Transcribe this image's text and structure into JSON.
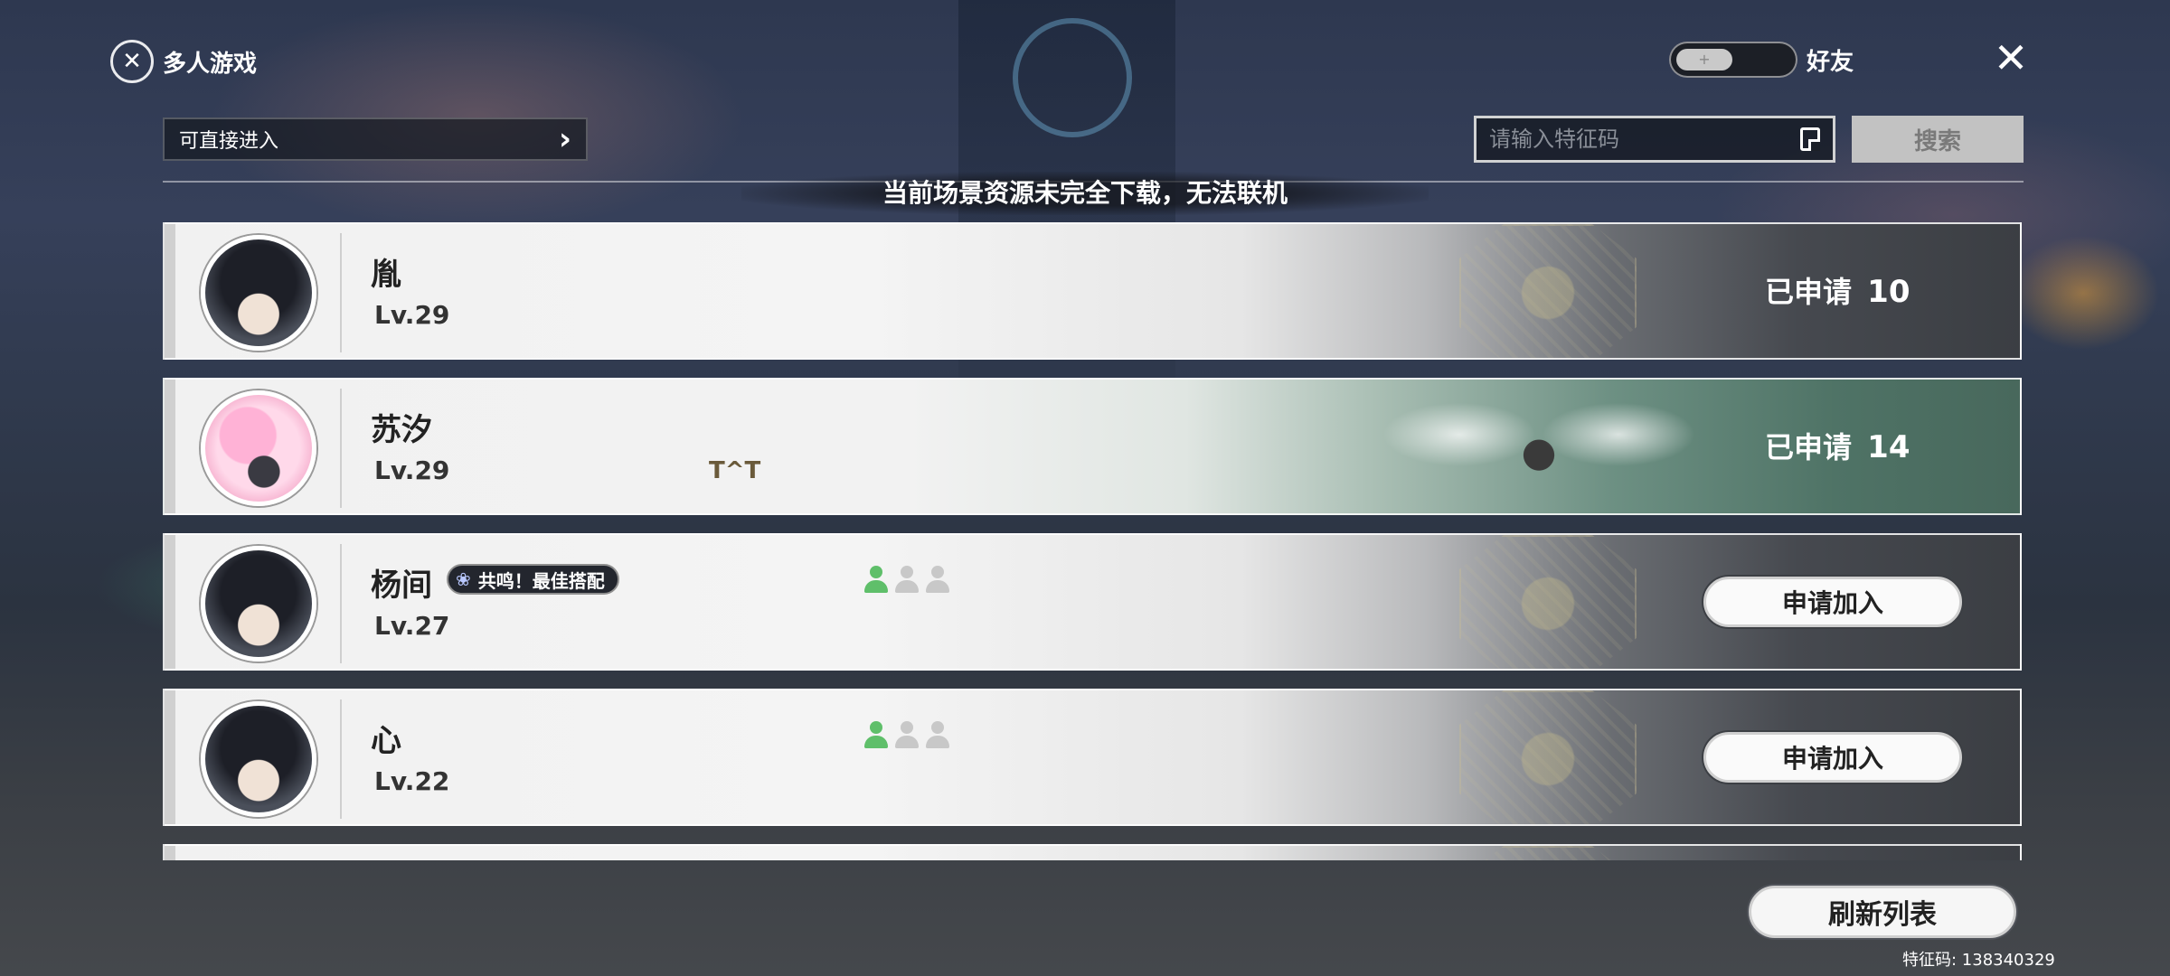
{
  "header": {
    "title": "多人游戏",
    "logo_icon": "multiplayer-globe-icon",
    "friend_toggle_label": "好友",
    "friend_toggle_state": "off",
    "close_icon": "close-icon"
  },
  "filter": {
    "selected": "可直接进入"
  },
  "search": {
    "placeholder": "请输入特征码",
    "button_label": "搜索"
  },
  "notice": "当前场景资源未完全下载，无法联机",
  "players": [
    {
      "name": "胤",
      "level": "Lv.29",
      "status_label": "已申请",
      "status_count": "10",
      "slots": null
    },
    {
      "name": "苏汐",
      "level": "Lv.29",
      "note": "T^T",
      "status_label": "已申请",
      "status_count": "14",
      "slots": null
    },
    {
      "name": "杨间",
      "level": "Lv.27",
      "badge": "共鸣！最佳搭配",
      "slots": [
        true,
        false,
        false
      ],
      "action_label": "申请加入"
    },
    {
      "name": "心",
      "level": "Lv.22",
      "slots": [
        true,
        false,
        false
      ],
      "action_label": "申请加入"
    }
  ],
  "refresh_label": "刷新列表",
  "feature_code": "特征码: 138340329",
  "colors": {
    "slot_active": "#5fbf6a",
    "slot_inactive": "#c8c8c8",
    "search_button_bg": "#c2c2c2"
  }
}
